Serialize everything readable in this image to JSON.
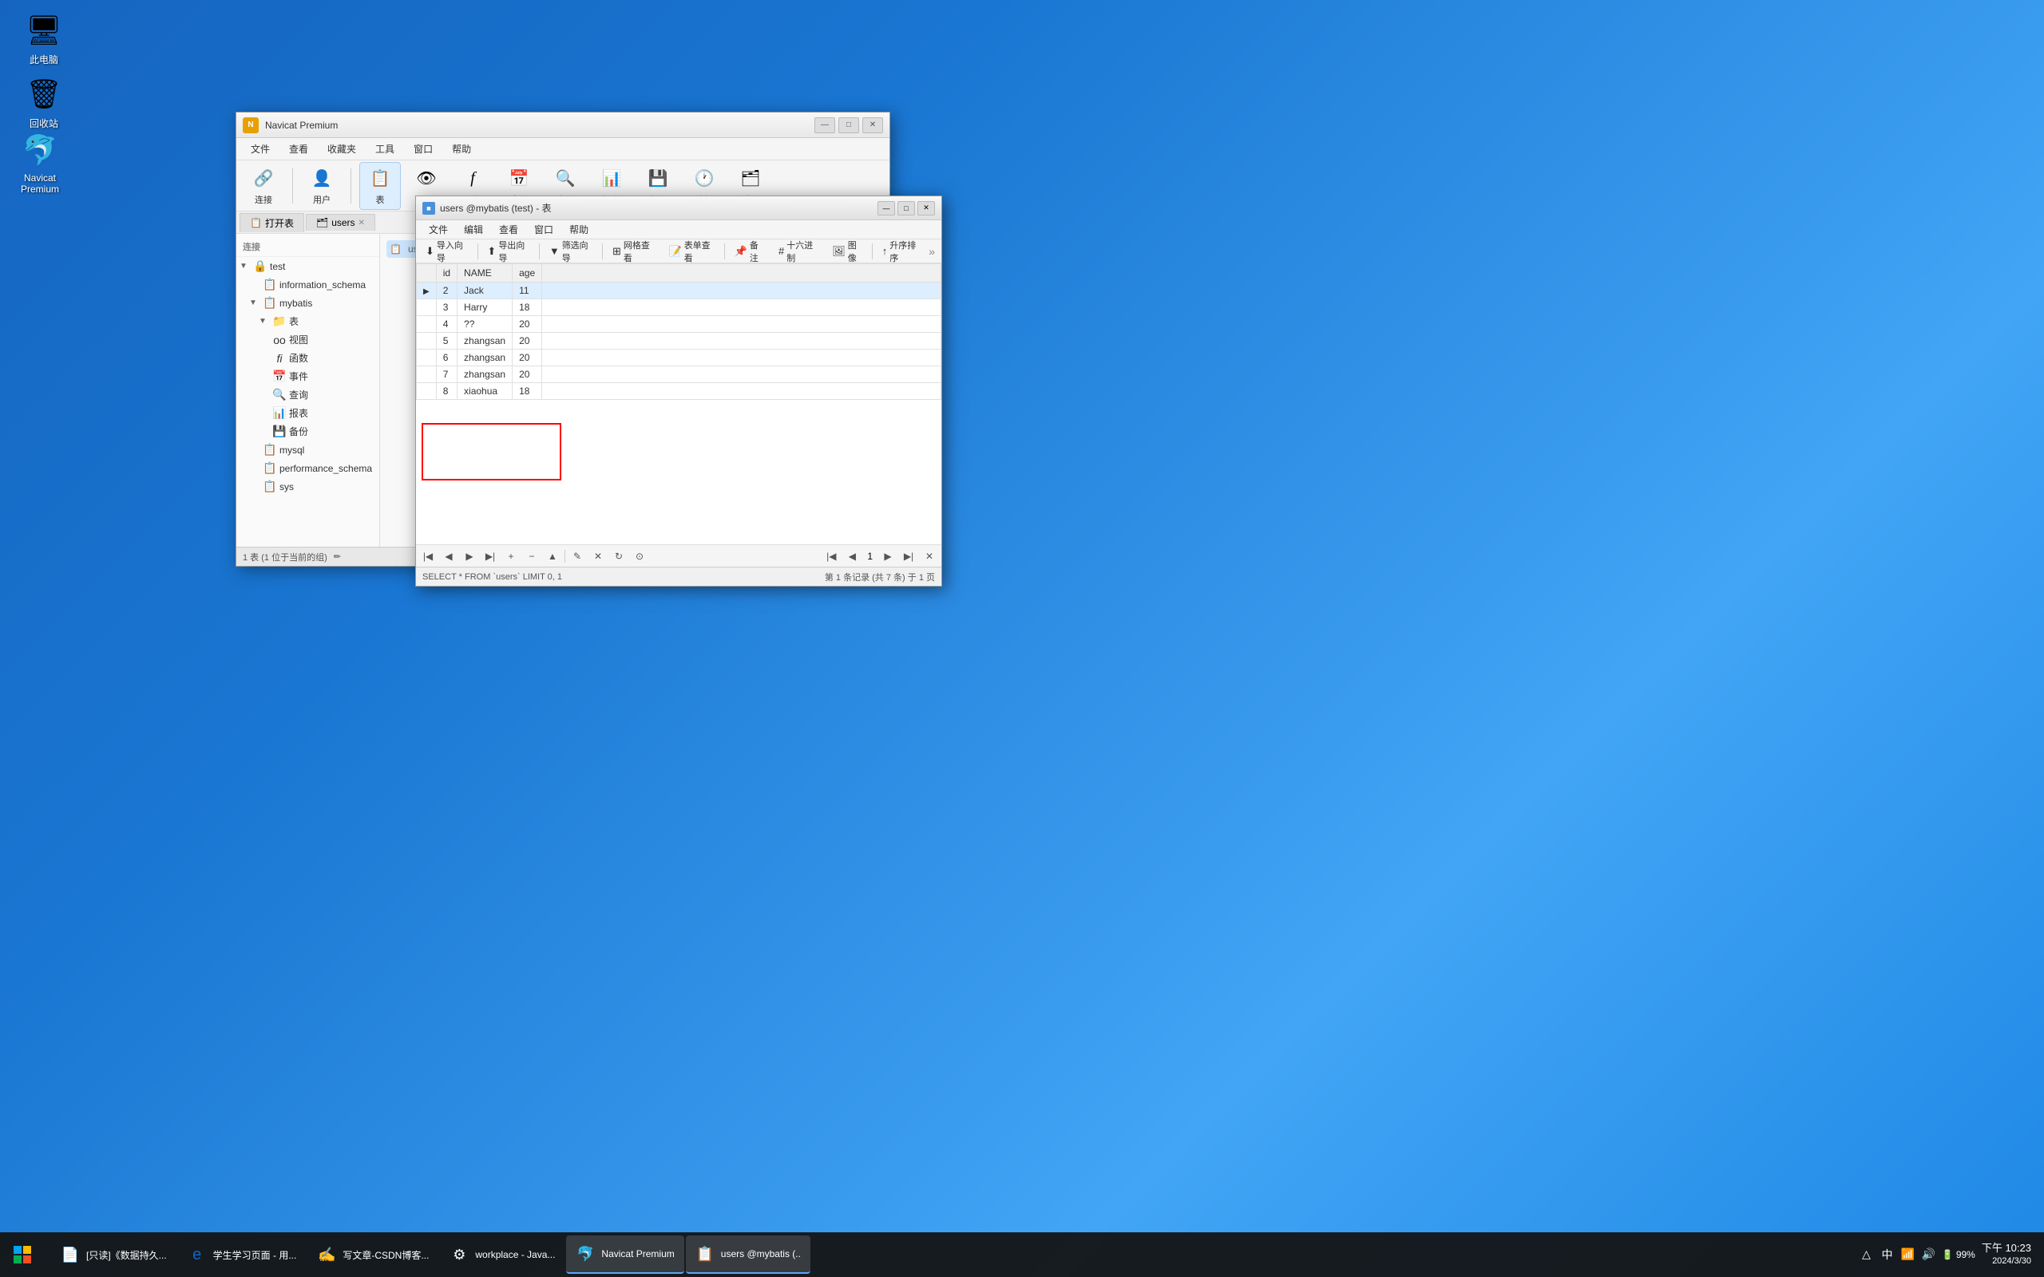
{
  "desktop": {
    "icons": [
      {
        "id": "computer",
        "label": "此电脑",
        "symbol": "🖥"
      },
      {
        "id": "recycle",
        "label": "回收站",
        "symbol": "🗑"
      }
    ]
  },
  "navicat_main": {
    "title": "Navicat Premium",
    "menus": [
      "文件",
      "查看",
      "收藏夹",
      "工具",
      "窗口",
      "帮助"
    ],
    "toolbar_buttons": [
      {
        "id": "connect",
        "label": "连接",
        "icon": "🔗"
      },
      {
        "id": "user",
        "label": "用户",
        "icon": "👤"
      },
      {
        "id": "table",
        "label": "表",
        "icon": "📋"
      },
      {
        "id": "view",
        "label": "视图",
        "icon": "👁"
      },
      {
        "id": "function",
        "label": "函数",
        "icon": "ƒ"
      },
      {
        "id": "event",
        "label": "事件",
        "icon": "📅"
      },
      {
        "id": "query",
        "label": "查询",
        "icon": "🔍"
      },
      {
        "id": "report",
        "label": "报表",
        "icon": "📊"
      },
      {
        "id": "backup",
        "label": "备份",
        "icon": "💾"
      },
      {
        "id": "schedule",
        "label": "计划",
        "icon": "🕐"
      },
      {
        "id": "model",
        "label": "模型",
        "icon": "🗂"
      }
    ],
    "sidebar": {
      "header": "连接",
      "tree": [
        {
          "label": "test",
          "level": 0,
          "type": "db",
          "expanded": true,
          "icon": "🗄"
        },
        {
          "label": "information_schema",
          "level": 1,
          "type": "schema",
          "icon": "📋"
        },
        {
          "label": "mybatis",
          "level": 1,
          "type": "schema",
          "expanded": true,
          "icon": "📋"
        },
        {
          "label": "表",
          "level": 2,
          "type": "folder",
          "expanded": true,
          "icon": "📁"
        },
        {
          "label": "视图",
          "level": 2,
          "type": "folder",
          "icon": "📁"
        },
        {
          "label": "函数",
          "level": 2,
          "type": "folder",
          "icon": "📁"
        },
        {
          "label": "事件",
          "level": 2,
          "type": "folder",
          "icon": "📁"
        },
        {
          "label": "查询",
          "level": 2,
          "type": "folder",
          "icon": "📁"
        },
        {
          "label": "报表",
          "level": 2,
          "type": "folder",
          "icon": "📁"
        },
        {
          "label": "备份",
          "level": 2,
          "type": "folder",
          "icon": "📁"
        },
        {
          "label": "mysql",
          "level": 1,
          "type": "schema",
          "icon": "📋"
        },
        {
          "label": "performance_schema",
          "level": 1,
          "type": "schema",
          "icon": "📋"
        },
        {
          "label": "sys",
          "level": 1,
          "type": "schema",
          "icon": "📋"
        }
      ]
    },
    "content_tab": "users",
    "status": "1 表 (1 位于当前的组)"
  },
  "table_window": {
    "title": "users @mybatis (test) - 表",
    "menus": [
      "文件",
      "编辑",
      "查看",
      "窗口",
      "帮助"
    ],
    "toolbar_buttons": [
      {
        "id": "import",
        "label": "导入向导",
        "icon": "⬇"
      },
      {
        "id": "export",
        "label": "导出向导",
        "icon": "⬆"
      },
      {
        "id": "filter",
        "label": "筛选向导",
        "icon": "▼"
      },
      {
        "id": "grid",
        "label": "网格查看",
        "icon": "⊞"
      },
      {
        "id": "form",
        "label": "表单查看",
        "icon": "📝"
      },
      {
        "id": "note",
        "label": "备注",
        "icon": "📌"
      },
      {
        "id": "hex",
        "label": "十六进制",
        "icon": "#"
      },
      {
        "id": "image",
        "label": "图像",
        "icon": "🖼"
      },
      {
        "id": "sort",
        "label": "升序排序",
        "icon": "↑"
      }
    ],
    "columns": [
      "id",
      "NAME",
      "age"
    ],
    "rows": [
      {
        "id": "2",
        "name": "Jack",
        "age": "11",
        "current": true
      },
      {
        "id": "3",
        "name": "Harry",
        "age": "18"
      },
      {
        "id": "4",
        "name": "??",
        "age": "20"
      },
      {
        "id": "5",
        "name": "zhangsan",
        "age": "20"
      },
      {
        "id": "6",
        "name": "zhangsan",
        "age": "20",
        "highlighted": true
      },
      {
        "id": "7",
        "name": "zhangsan",
        "age": "20",
        "highlighted": true
      },
      {
        "id": "8",
        "name": "xiaohua",
        "age": "18",
        "highlighted": true
      }
    ],
    "sql_query": "SELECT * FROM `users` LIMIT 0, 1",
    "status": "第 1 条记录 (共 7 条) 于 1 页"
  },
  "taskbar": {
    "start_icon": "⊞",
    "items": [
      {
        "id": "file-manager",
        "label": "[只读]《数据持久..."
      },
      {
        "id": "browser1",
        "label": "学生学习页面 - 用..."
      },
      {
        "id": "tianyige",
        "label": "写文章-CSDN博客..."
      },
      {
        "id": "workplace",
        "label": "workplace - Java..."
      },
      {
        "id": "navicat",
        "label": "Navicat Premium",
        "active": true
      },
      {
        "id": "users-table",
        "label": "users @mybatis (.."
      }
    ],
    "tray": {
      "battery": "99%",
      "time": "下午 10:23",
      "date": "2024/3/30",
      "wedge_icon": "△",
      "net_icon": "📶",
      "speaker_icon": "🔊",
      "input_icon": "中"
    }
  }
}
